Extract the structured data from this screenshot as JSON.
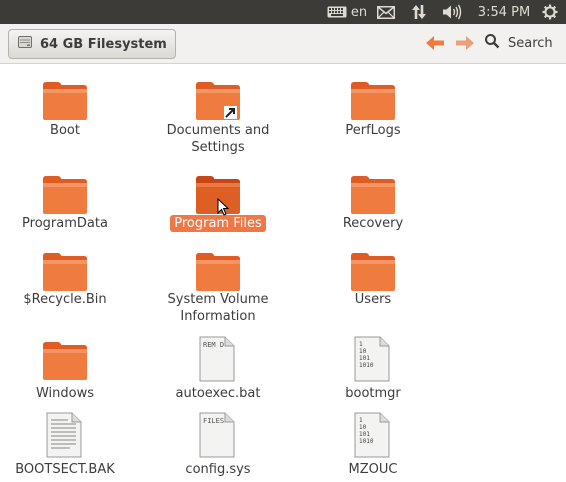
{
  "topbar": {
    "keyboard_icon": "keyboard-icon",
    "language": "en",
    "mail_icon": "mail-icon",
    "network_icon": "network-icon",
    "volume_icon": "volume-icon",
    "time": "3:54 PM",
    "settings_icon": "gear-icon"
  },
  "toolbar": {
    "location_label": "64 GB Filesystem",
    "drive_icon": "drive-icon",
    "back_icon": "arrow-left-icon",
    "forward_icon": "arrow-right-icon",
    "search_label": "Search"
  },
  "colors": {
    "topbar_bg": "#3c3b37",
    "folder_orange": "#ef7b3f",
    "folder_tab": "#e7692e",
    "selection": "#f07746"
  },
  "files": [
    {
      "name": "Boot",
      "type": "folder"
    },
    {
      "name": "Documents and Settings",
      "type": "folder-link"
    },
    {
      "name": "PerfLogs",
      "type": "folder"
    },
    {
      "name": "ProgramData",
      "type": "folder"
    },
    {
      "name": "Program Files",
      "type": "folder",
      "selected": true
    },
    {
      "name": "Recovery",
      "type": "folder"
    },
    {
      "name": "$Recycle.Bin",
      "type": "folder"
    },
    {
      "name": "System Volume Information",
      "type": "folder"
    },
    {
      "name": "Users",
      "type": "folder"
    },
    {
      "name": "Windows",
      "type": "folder"
    },
    {
      "name": "autoexec.bat",
      "type": "text",
      "preview": "REM D"
    },
    {
      "name": "bootmgr",
      "type": "binary",
      "preview": "1\n10\n101\n1010"
    },
    {
      "name": "BOOTSECT.BAK",
      "type": "document"
    },
    {
      "name": "config.sys",
      "type": "text",
      "preview": "FILES"
    },
    {
      "name": "MZOUC",
      "type": "binary",
      "preview": "1\n10\n101\n1010"
    }
  ]
}
